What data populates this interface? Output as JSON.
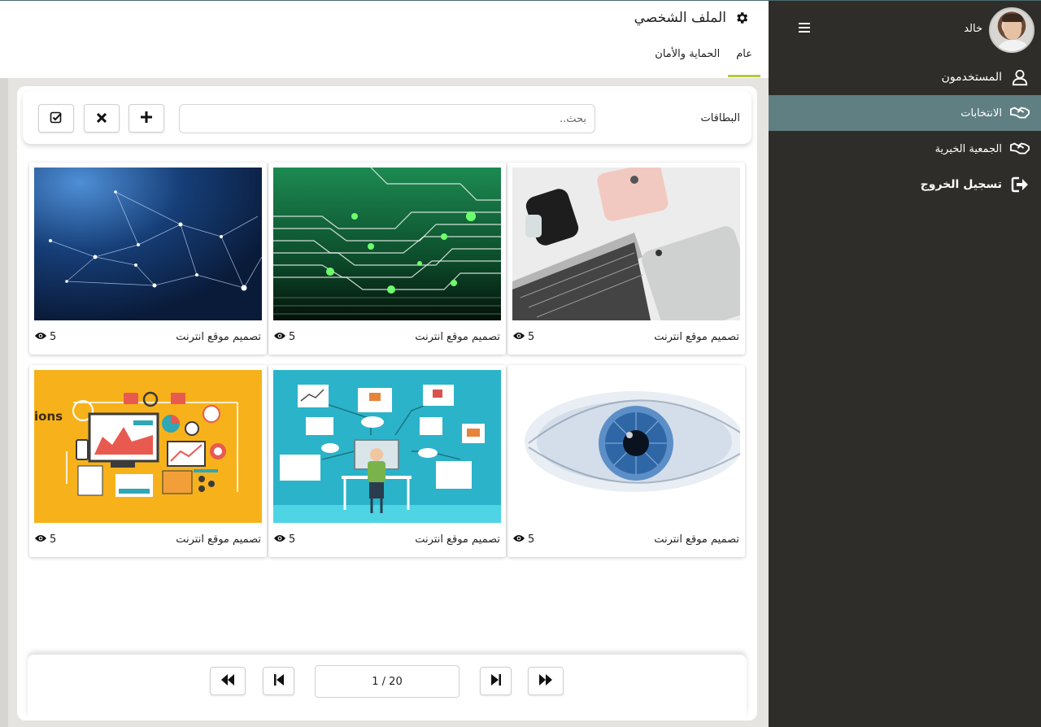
{
  "sidebar": {
    "user_name": "خالد",
    "items": [
      {
        "label": "المستخدمون",
        "icon": "user-icon"
      },
      {
        "label": "الانتخابات",
        "icon": "handshake-icon",
        "active": true
      },
      {
        "label": "الجمعية الخيرية",
        "icon": "handshake-icon"
      },
      {
        "label": "تسجيل الخروج",
        "icon": "logout-icon"
      }
    ]
  },
  "header": {
    "title": "الملف الشخصي",
    "tabs": [
      {
        "label": "عام",
        "active": true
      },
      {
        "label": "الحماية والأمان"
      }
    ]
  },
  "toolbar": {
    "label": "البطاقات",
    "search_placeholder": "بحث..",
    "buttons": [
      "plus-icon",
      "close-icon",
      "checkbox-icon"
    ]
  },
  "cards": [
    {
      "title": "تصميم موقع انترنت",
      "views": "5",
      "image": "devices-photo"
    },
    {
      "title": "تصميم موقع انترنت",
      "views": "5",
      "image": "circuit-board-photo"
    },
    {
      "title": "تصميم موقع انترنت",
      "views": "5",
      "image": "network-nodes-photo"
    },
    {
      "title": "تصميم موقع انترنت",
      "views": "5",
      "image": "eye-photo"
    },
    {
      "title": "تصميم موقع انترنت",
      "views": "5",
      "image": "developer-illustration"
    },
    {
      "title": "تصميم موقع انترنت",
      "views": "5",
      "image": "analytics-illustration"
    }
  ],
  "pagination": {
    "indicator": "1 / 20"
  },
  "colors": {
    "sidebar_bg": "#2f2d2a",
    "active_item": "#5f7f82",
    "tab_underline": "#b6c93b"
  }
}
